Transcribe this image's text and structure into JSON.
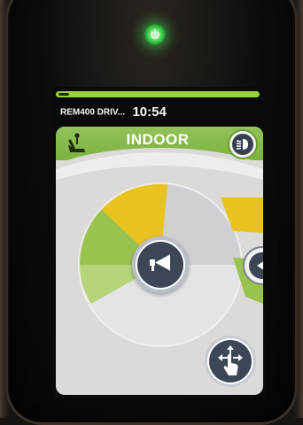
{
  "device": {
    "power_led_color": "#4ee05a",
    "power_icon": "power-icon"
  },
  "status_bar": {
    "battery_color": "#9bd23f",
    "device_name": "REM400 DRIV...",
    "time": "10:54"
  },
  "mode_panel": {
    "title": "INDOOR",
    "header_color": "#7cb23f",
    "seat_icon": "seat-adjust-icon",
    "lights_icon": "headlights-icon"
  },
  "speed_dial": {
    "colors": {
      "green": "#9ac24f",
      "yellow": "#e8c21f",
      "grey": "#cfcfd2"
    }
  },
  "controls": {
    "horn_icon": "horn-icon",
    "next_icon": "chevron-left-icon",
    "move_icon": "touch-move-icon"
  }
}
